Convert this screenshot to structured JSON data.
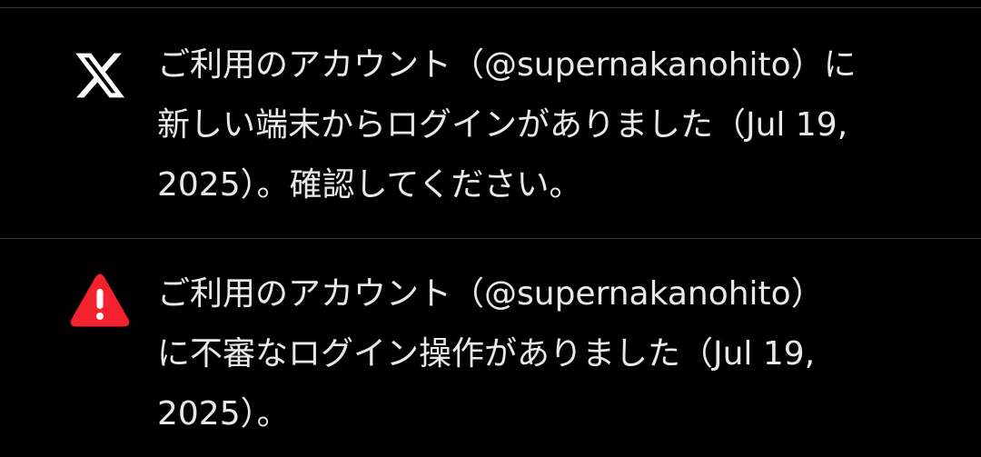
{
  "notifications": [
    {
      "icon": "x-logo-icon",
      "lines": [
        "ご利用のアカウント（@supernakanohito）に",
        "新しい端末からログインがありました（Jul 19,",
        "2025）。確認してください。"
      ]
    },
    {
      "icon": "warning-icon",
      "icon_color": "#f4212e",
      "lines": [
        "ご利用のアカウント（@supernakanohito）",
        "に不審なログイン操作がありました（Jul 19,",
        "2025）。"
      ]
    }
  ],
  "colors": {
    "background": "#000000",
    "text": "#e7e9ea",
    "divider": "#2f3336",
    "warning": "#f4212e"
  }
}
